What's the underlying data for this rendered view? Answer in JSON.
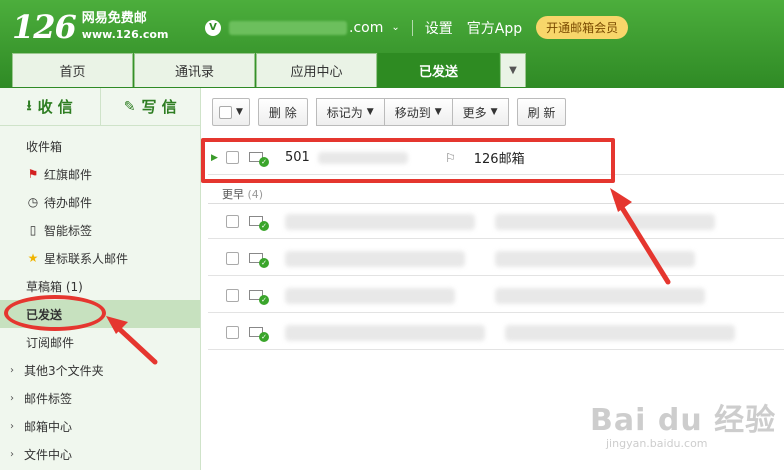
{
  "header": {
    "logo_num": "126",
    "logo_cn": "网易免费邮",
    "logo_url": "www.126.com",
    "vip_badge": "V",
    "email_suffix": ".com",
    "settings": "设置",
    "app": "官方App",
    "vip_button": "开通邮箱会员"
  },
  "tabs": [
    {
      "label": "首页",
      "active": false
    },
    {
      "label": "通讯录",
      "active": false
    },
    {
      "label": "应用中心",
      "active": false
    },
    {
      "label": "已发送",
      "active": true
    }
  ],
  "sidebar": {
    "receive": "收 信",
    "compose": "写 信",
    "folders": [
      {
        "label": "收件箱",
        "icon": ""
      },
      {
        "label": "红旗邮件",
        "icon": "red-flag-icon"
      },
      {
        "label": "待办邮件",
        "icon": "clock-icon"
      },
      {
        "label": "智能标签",
        "icon": "bookmark-icon"
      },
      {
        "label": "星标联系人邮件",
        "icon": "star-icon"
      },
      {
        "label": "草稿箱 (1)",
        "icon": ""
      },
      {
        "label": "已发送",
        "icon": "",
        "active": true
      },
      {
        "label": "订阅邮件",
        "icon": ""
      }
    ],
    "groups": [
      {
        "label": "其他3个文件夹"
      },
      {
        "label": "邮件标签"
      },
      {
        "label": "邮箱中心"
      },
      {
        "label": "文件中心"
      }
    ]
  },
  "toolbar": {
    "delete": "删 除",
    "mark_as": "标记为",
    "move_to": "移动到",
    "more": "更多",
    "refresh": "刷 新"
  },
  "mail_list": {
    "first_row": {
      "recipient": "501",
      "subject": "126邮箱"
    },
    "group_label": "更早",
    "group_count": "(4)"
  },
  "watermark": {
    "main": "Bai du 经验",
    "sub": "jingyan.baidu.com"
  },
  "colors": {
    "header_green": "#2f8a25",
    "annotation_red": "#e5362f",
    "active_folder_bg": "#c7e1bf"
  }
}
